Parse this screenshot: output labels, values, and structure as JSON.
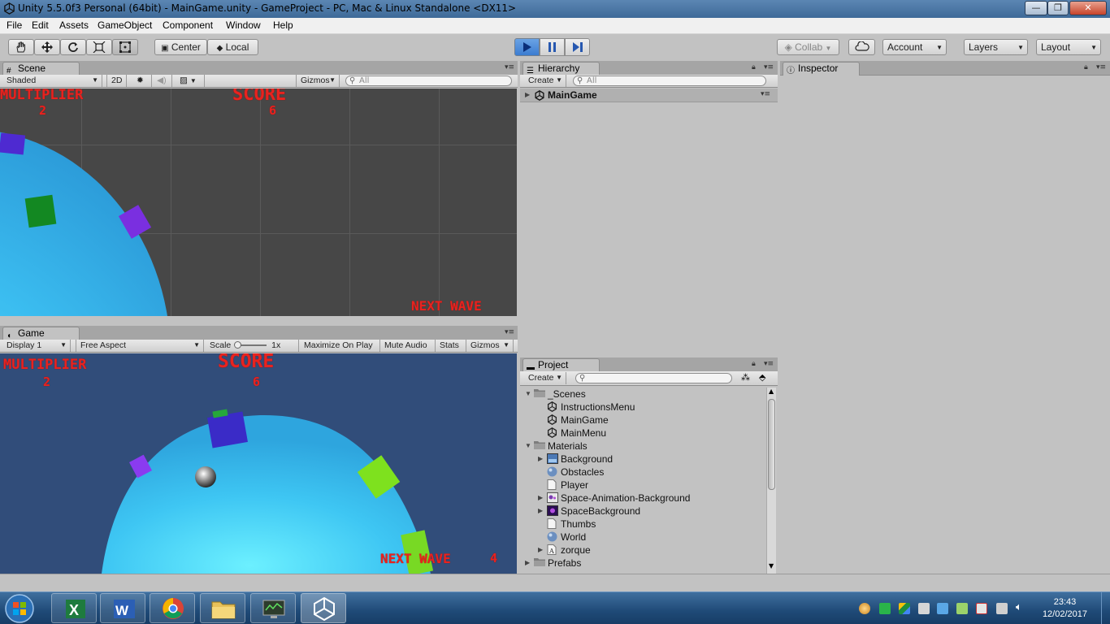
{
  "window": {
    "title": "Unity 5.5.0f3 Personal (64bit) - MainGame.unity - GameProject - PC, Mac & Linux Standalone <DX11>",
    "minimize": "—",
    "maximize": "❐",
    "close": "✕"
  },
  "menu": [
    "File",
    "Edit",
    "Assets",
    "GameObject",
    "Component",
    "Window",
    "Help"
  ],
  "toolbar": {
    "pivot": "Center",
    "space": "Local",
    "collab": "Collab",
    "account": "Account",
    "layers": "Layers",
    "layout": "Layout"
  },
  "scene": {
    "tab": "Scene",
    "shading": "Shaded",
    "mode_2d": "2D",
    "gizmos": "Gizmos",
    "search_placeholder": "All",
    "hud": {
      "multiplier_label": "MULTIPLIER",
      "multiplier_value": "2",
      "score_label": "SCORE",
      "score_value": "6",
      "next_wave": "NEXT WAVE"
    }
  },
  "game": {
    "tab": "Game",
    "display": "Display 1",
    "aspect": "Free Aspect",
    "scale_label": "Scale",
    "scale_value": "1x",
    "maximize": "Maximize On Play",
    "mute": "Mute Audio",
    "stats": "Stats",
    "gizmos": "Gizmos",
    "hud": {
      "multiplier_label": "MULTIPLIER",
      "multiplier_value": "2",
      "score_label": "SCORE",
      "score_value": "6",
      "next_wave": "NEXT WAVE",
      "wave_number": "4"
    }
  },
  "hierarchy": {
    "tab": "Hierarchy",
    "create": "Create",
    "search_placeholder": "All",
    "scene_root": "MainGame"
  },
  "inspector": {
    "tab": "Inspector"
  },
  "project": {
    "tab": "Project",
    "create": "Create",
    "items": [
      {
        "label": "_Scenes",
        "kind": "folder",
        "depth": 0,
        "expanded": true
      },
      {
        "label": "InstructionsMenu",
        "kind": "scene",
        "depth": 1
      },
      {
        "label": "MainGame",
        "kind": "scene",
        "depth": 1
      },
      {
        "label": "MainMenu",
        "kind": "scene",
        "depth": 1
      },
      {
        "label": "Materials",
        "kind": "folder",
        "depth": 0,
        "expanded": true
      },
      {
        "label": "Background",
        "kind": "texture",
        "depth": 1,
        "collapsed": true
      },
      {
        "label": "Obstacles",
        "kind": "material",
        "depth": 1
      },
      {
        "label": "Player",
        "kind": "file",
        "depth": 1
      },
      {
        "label": "Space-Animation-Background",
        "kind": "anim",
        "depth": 1,
        "collapsed": true
      },
      {
        "label": "SpaceBackground",
        "kind": "space",
        "depth": 1,
        "collapsed": true
      },
      {
        "label": "Thumbs",
        "kind": "file",
        "depth": 1
      },
      {
        "label": "World",
        "kind": "material",
        "depth": 1
      },
      {
        "label": "zorque",
        "kind": "font",
        "depth": 1,
        "collapsed": true
      },
      {
        "label": "Prefabs",
        "kind": "folder",
        "depth": 0,
        "collapsed": true
      }
    ]
  },
  "taskbar": {
    "time": "23:43",
    "date": "12/02/2017",
    "apps": [
      "excel-app",
      "word-app",
      "chrome-app",
      "explorer-app",
      "monitor-app",
      "unity-app"
    ]
  },
  "colors": {
    "hud_red": "#e8231f",
    "planet": "#3fc6f2",
    "game_bg": "#314d7a",
    "scene_bg": "#474747"
  }
}
